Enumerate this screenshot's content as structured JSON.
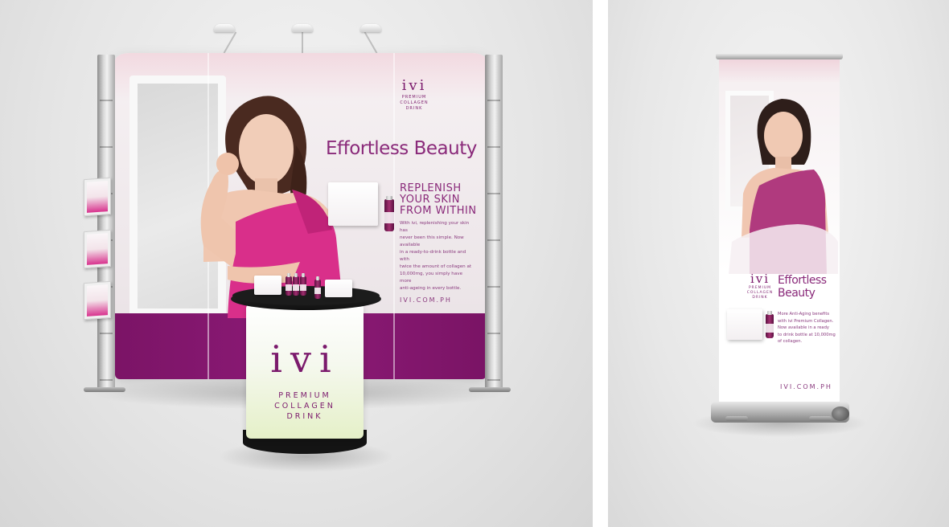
{
  "booth": {
    "logo": "ivi",
    "logo_sub": [
      "PREMIUM",
      "COLLAGEN",
      "DRINK"
    ],
    "headline": "Effortless Beauty",
    "tagline": [
      "REPLENISH",
      "YOUR SKIN",
      "FROM WITHIN"
    ],
    "body": [
      "With ivi, replenishing your skin has",
      "never been this simple. Now available",
      "in a ready-to-drink bottle and with",
      "twice the amount of collagen at",
      "10,000mg, you simply have more",
      "anti-ageing in every bottle."
    ],
    "url": "IVI.COM.PH"
  },
  "counter": {
    "logo": "ivi",
    "sub": [
      "PREMIUM",
      "COLLAGEN",
      "DRINK"
    ]
  },
  "banner": {
    "logo": "ivi",
    "logo_sub": [
      "PREMIUM",
      "COLLAGEN",
      "DRINK"
    ],
    "headline": [
      "Effortless",
      "Beauty"
    ],
    "body": [
      "More Anti-Aging benefits",
      "with ivi Premium Collagen.",
      "Now available in a ready",
      "to drink bottle at 10,000mg",
      "of collagen."
    ],
    "url": "IVI.COM.PH"
  },
  "colors": {
    "brand_purple": "#7b1a6c",
    "magenta_dress": "#d8338e",
    "counter_green": "#e5f0c8"
  }
}
